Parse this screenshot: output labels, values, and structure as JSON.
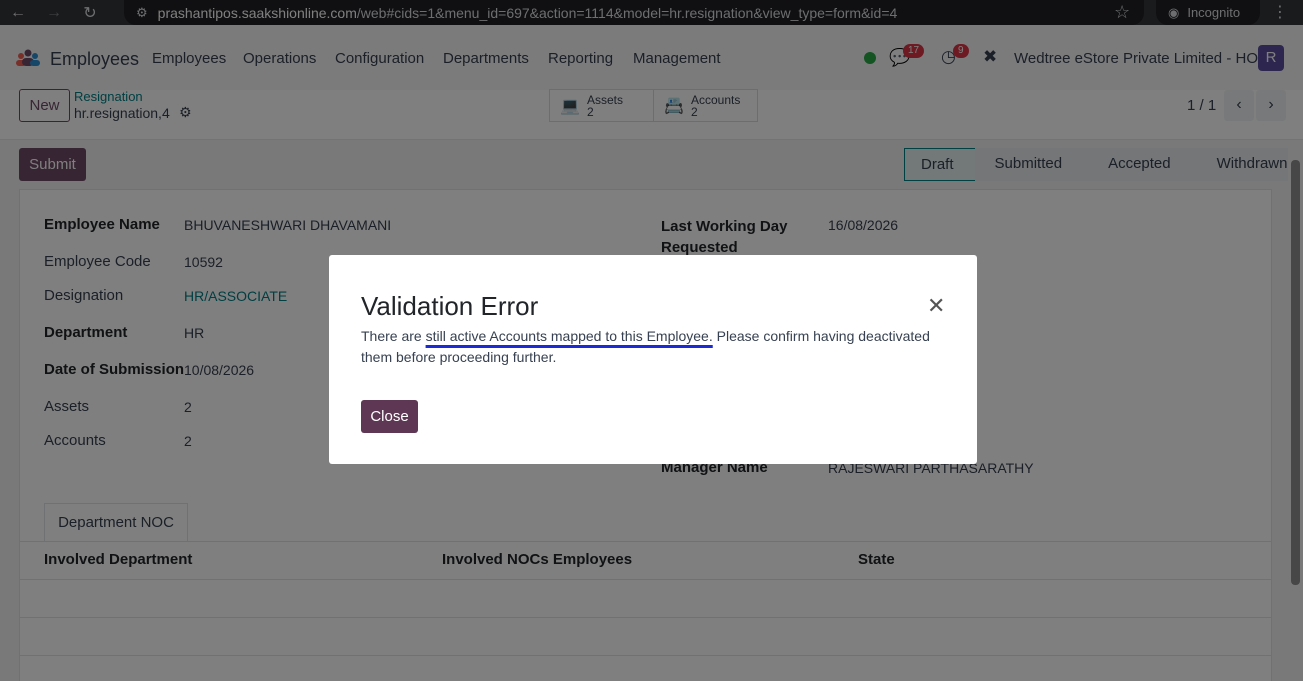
{
  "browser": {
    "url_host": "prashantipos.saakshionline.com",
    "url_path": "/web#cids=1&menu_id=697&action=1114&model=hr.resignation&view_type=form&id=4",
    "incognito_label": "Incognito"
  },
  "navbar": {
    "app_name": "Employees",
    "menu": [
      "Employees",
      "Operations",
      "Configuration",
      "Departments",
      "Reporting",
      "Management"
    ],
    "messages_count": "17",
    "activities_count": "9",
    "company": "Wedtree eStore Private Limited - HO",
    "avatar_letter": "R"
  },
  "control_panel": {
    "new_label": "New",
    "breadcrumb_parent": "Resignation",
    "breadcrumb_current": "hr.resignation,4",
    "smart_buttons": [
      {
        "label": "Assets",
        "count": "2",
        "icon": "laptop-icon"
      },
      {
        "label": "Accounts",
        "count": "2",
        "icon": "id-card-icon"
      }
    ],
    "pager": "1 / 1"
  },
  "form": {
    "submit_label": "Submit",
    "statuses": [
      "Draft",
      "Submitted",
      "Accepted",
      "Withdrawn"
    ],
    "active_status": "Draft",
    "fields_left": [
      {
        "label": "Employee Name",
        "value": "BHUVANESHWARI DHAVAMANI",
        "bold": true
      },
      {
        "label": "Employee Code",
        "value": "10592",
        "bold": false
      },
      {
        "label": "Designation",
        "value": "HR/ASSOCIATE",
        "bold": false,
        "link": true
      },
      {
        "label": "Department",
        "value": "HR",
        "bold": true
      },
      {
        "label": "Date of Submission",
        "value": "10/08/2026",
        "bold": true
      },
      {
        "label": "Assets",
        "value": "2",
        "bold": false
      },
      {
        "label": "Accounts",
        "value": "2",
        "bold": false
      }
    ],
    "last_working_day_label_1": "Last Working Day",
    "last_working_day_label_2": "Requested",
    "last_working_day_value": "16/08/2026",
    "manager_label": "Manager Name",
    "manager_value": "RAJESWARI PARTHASARATHY",
    "tab_label": "Department NOC",
    "table_headers": [
      "Involved Department",
      "Involved NOCs Employees",
      "State"
    ]
  },
  "dialog": {
    "title": "Validation Error",
    "body_before": "There are ",
    "body_highlight": "still active Accounts mapped to this Employee.",
    "body_after": " Please confirm having deactivated them before proceeding further.",
    "close_label": "Close"
  },
  "colors": {
    "primary": "#714b67",
    "link": "#017e84",
    "underline": "#1a2bd6"
  }
}
